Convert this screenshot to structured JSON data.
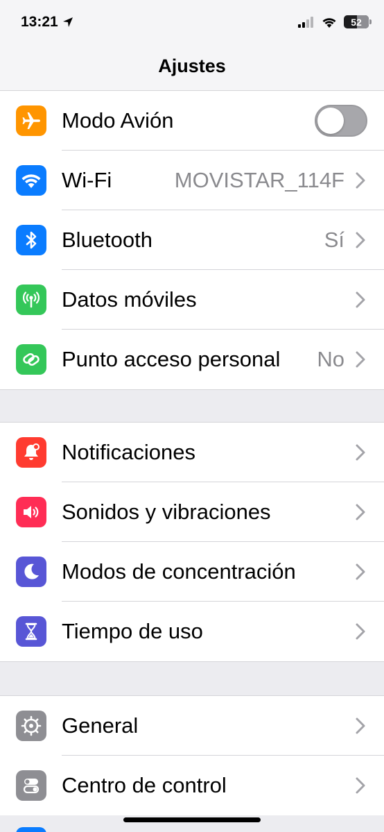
{
  "status_bar": {
    "time": "13:21",
    "battery": "52",
    "battery_level": 0.52
  },
  "nav": {
    "title": "Ajustes"
  },
  "groups": [
    {
      "items": [
        {
          "label": "Modo Avión",
          "value": "",
          "icon": "airplane-icon",
          "color": "#ff9500",
          "toggle": false
        },
        {
          "label": "Wi-Fi",
          "value": "MOVISTAR_114F",
          "icon": "wifi-icon",
          "color": "#0a7cff"
        },
        {
          "label": "Bluetooth",
          "value": "Sí",
          "icon": "bluetooth-icon",
          "color": "#0a7cff"
        },
        {
          "label": "Datos móviles",
          "value": "",
          "icon": "antenna-icon",
          "color": "#34c759"
        },
        {
          "label": "Punto acceso personal",
          "value": "No",
          "icon": "hotspot-link-icon",
          "color": "#34c759"
        }
      ]
    },
    {
      "items": [
        {
          "label": "Notificaciones",
          "value": "",
          "icon": "bell-icon",
          "color": "#ff3b30"
        },
        {
          "label": "Sonidos y vibraciones",
          "value": "",
          "icon": "speaker-icon",
          "color": "#ff2d55"
        },
        {
          "label": "Modos de concentración",
          "value": "",
          "icon": "moon-icon",
          "color": "#5856d6"
        },
        {
          "label": "Tiempo de uso",
          "value": "",
          "icon": "hourglass-icon",
          "color": "#5856d6"
        }
      ]
    },
    {
      "items": [
        {
          "label": "General",
          "value": "",
          "icon": "gear-icon",
          "color": "#8e8e93"
        },
        {
          "label": "Centro de control",
          "value": "",
          "icon": "switches-icon",
          "color": "#8e8e93"
        }
      ]
    }
  ]
}
